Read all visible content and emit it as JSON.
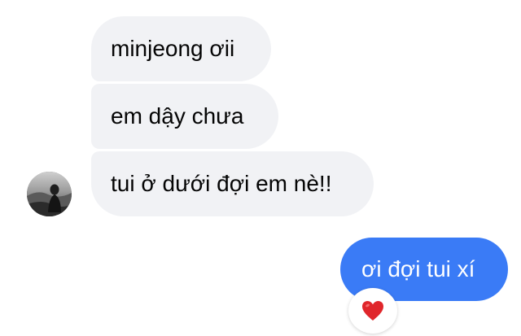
{
  "messages": [
    {
      "direction": "incoming",
      "text": "minjeong ơii"
    },
    {
      "direction": "incoming",
      "text": "em dậy chưa"
    },
    {
      "direction": "incoming",
      "text": "tui ở dưới đợi em nè!!"
    },
    {
      "direction": "outgoing",
      "text": "ơi đợi tui xí"
    }
  ],
  "reaction": {
    "icon": "red-heart-icon"
  },
  "avatar": {
    "icon": "person-photo"
  },
  "colors": {
    "incoming_bubble": "#f1f2f5",
    "outgoing_bubble": "#3a7bf6",
    "heart": "#e0262b"
  }
}
